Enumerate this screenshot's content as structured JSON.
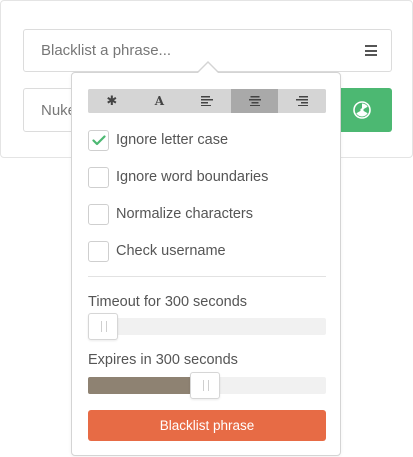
{
  "phrase_input": {
    "placeholder": "Blacklist a phrase..."
  },
  "nuke_input": {
    "placeholder": "Nuke phrase..."
  },
  "nuke_button": {
    "icon": "radiation-icon",
    "color": "#4cb872"
  },
  "popover": {
    "modes": [
      {
        "icon": "asterisk-icon",
        "glyph": "✱",
        "active": false
      },
      {
        "icon": "font-icon",
        "glyph": "A",
        "active": false
      },
      {
        "icon": "align-left-icon",
        "active": false
      },
      {
        "icon": "align-center-icon",
        "active": true
      },
      {
        "icon": "align-right-icon",
        "active": false
      }
    ],
    "options": [
      {
        "label": "Ignore letter case",
        "checked": true
      },
      {
        "label": "Ignore word boundaries",
        "checked": false
      },
      {
        "label": "Normalize characters",
        "checked": false
      },
      {
        "label": "Check username",
        "checked": false
      }
    ],
    "timeout": {
      "label": "Timeout for 300 seconds",
      "seconds": 300,
      "fraction": 0.03
    },
    "expires": {
      "label": "Expires in 300 seconds",
      "seconds": 300,
      "fraction": 0.49
    },
    "submit_label": "Blacklist phrase",
    "submit_color": "#e76b45",
    "check_color": "#4cb872"
  }
}
